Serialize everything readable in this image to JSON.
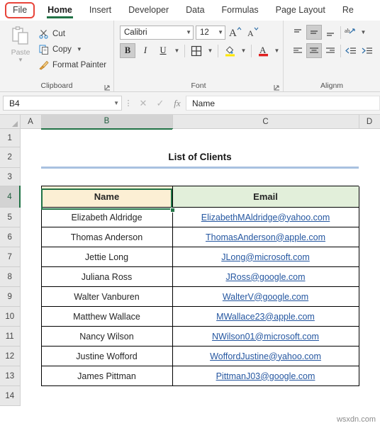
{
  "ribbon_tabs": [
    {
      "label": "File",
      "id": "file",
      "active": false,
      "highlighted": true
    },
    {
      "label": "Home",
      "id": "home",
      "active": true,
      "highlighted": false
    },
    {
      "label": "Insert",
      "id": "insert",
      "active": false,
      "highlighted": false
    },
    {
      "label": "Developer",
      "id": "developer",
      "active": false,
      "highlighted": false
    },
    {
      "label": "Data",
      "id": "data",
      "active": false,
      "highlighted": false
    },
    {
      "label": "Formulas",
      "id": "formulas",
      "active": false,
      "highlighted": false
    },
    {
      "label": "Page Layout",
      "id": "page-layout",
      "active": false,
      "highlighted": false
    },
    {
      "label": "Re",
      "id": "review",
      "active": false,
      "highlighted": false
    }
  ],
  "ribbon": {
    "clipboard": {
      "group_label": "Clipboard",
      "paste_label": "Paste",
      "cut_label": "Cut",
      "copy_label": "Copy",
      "format_painter_label": "Format Painter"
    },
    "font": {
      "group_label": "Font",
      "font_name": "Calibri",
      "font_size": "12",
      "bold_label": "B",
      "italic_label": "I",
      "underline_label": "U",
      "grow_font_label": "A",
      "shrink_font_label": "A",
      "highlight_color": "#ffe700",
      "font_color": "#e02020"
    },
    "alignment": {
      "group_label": "Alignm"
    }
  },
  "formula_bar": {
    "name_box_value": "B4",
    "formula_value": "Name",
    "cancel_label": "✕",
    "enter_label": "✓",
    "fx_label": "fx"
  },
  "grid": {
    "columns": [
      "A",
      "B",
      "C",
      "D"
    ],
    "selected_column": "B",
    "rows": [
      "1",
      "2",
      "3",
      "4",
      "5",
      "6",
      "7",
      "8",
      "9",
      "10",
      "11",
      "12",
      "13",
      "14"
    ],
    "selected_row": "4",
    "active_cell": "B4",
    "title": "List of Clients",
    "headers": {
      "name": "Name",
      "email": "Email"
    },
    "records": [
      {
        "row": "5",
        "name": "Elizabeth Aldridge",
        "email": "ElizabethMAldridge@yahoo.com"
      },
      {
        "row": "6",
        "name": "Thomas Anderson",
        "email": "ThomasAnderson@apple.com"
      },
      {
        "row": "7",
        "name": "Jettie Long",
        "email": "JLong@microsoft.com"
      },
      {
        "row": "8",
        "name": "Juliana Ross",
        "email": "JRoss@google.com"
      },
      {
        "row": "9",
        "name": "Walter Vanburen",
        "email": "WalterV@google.com"
      },
      {
        "row": "10",
        "name": "Matthew Wallace",
        "email": "MWallace23@apple.com"
      },
      {
        "row": "11",
        "name": "Nancy Wilson",
        "email": "NWilson01@microsoft.com"
      },
      {
        "row": "12",
        "name": "Justine Wofford",
        "email": "WoffordJustine@yahoo.com"
      },
      {
        "row": "13",
        "name": "James Pittman",
        "email": "PittmanJ03@google.com"
      }
    ]
  },
  "watermark": "wsxdn.com",
  "colors": {
    "excel_green": "#217346",
    "header_name_fill": "#fcefd4",
    "header_email_fill": "#e2efda",
    "hyperlink": "#2456a0",
    "title_underline": "#a8c1e0",
    "file_highlight": "#e8443a"
  }
}
